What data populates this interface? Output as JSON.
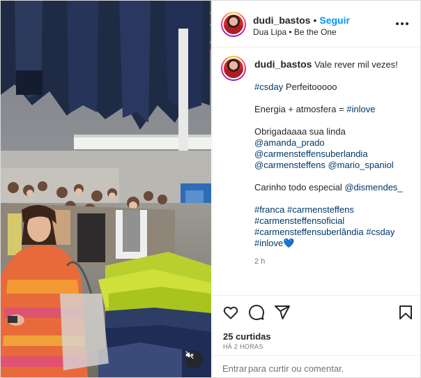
{
  "post": {
    "username": "dudi_bastos",
    "follow_label": "Seguir",
    "audio_artist": "Dua Lipa",
    "audio_track": "Be the One",
    "caption_lines": [
      {
        "segments": [
          {
            "text": "Vale rever mil vezes!",
            "link": false
          }
        ]
      },
      {
        "gap": true
      },
      {
        "segments": [
          {
            "text": "#csday",
            "link": true
          },
          {
            "text": " Perfeitooooo",
            "link": false
          }
        ]
      },
      {
        "gap": true
      },
      {
        "segments": [
          {
            "text": "Energia + atmosfera = ",
            "link": false
          },
          {
            "text": "#inlove",
            "link": true
          }
        ]
      },
      {
        "gap": true
      },
      {
        "segments": [
          {
            "text": "Obrigadaaaa sua linda",
            "link": false
          }
        ]
      },
      {
        "segments": [
          {
            "text": "@amanda_prado",
            "link": true
          }
        ]
      },
      {
        "segments": [
          {
            "text": "@carmensteffensuberlandia",
            "link": true
          }
        ]
      },
      {
        "segments": [
          {
            "text": "@carmensteffens",
            "link": true
          },
          {
            "text": " ",
            "link": false
          },
          {
            "text": "@mario_spaniol",
            "link": true
          }
        ]
      },
      {
        "gap": true
      },
      {
        "segments": [
          {
            "text": "Carinho todo especial ",
            "link": false
          },
          {
            "text": "@dismendes_",
            "link": true
          }
        ]
      },
      {
        "gap": true
      },
      {
        "segments": [
          {
            "text": "#franca",
            "link": true
          },
          {
            "text": " ",
            "link": false
          },
          {
            "text": "#carmensteffens",
            "link": true
          }
        ]
      },
      {
        "segments": [
          {
            "text": "#carmensteffensoficial",
            "link": true
          }
        ]
      },
      {
        "segments": [
          {
            "text": "#carmensteffensuberlândia",
            "link": true
          },
          {
            "text": " ",
            "link": false
          },
          {
            "text": "#csday",
            "link": true
          }
        ]
      },
      {
        "segments": [
          {
            "text": "#inlove",
            "link": true
          },
          {
            "text": "💙",
            "link": false
          }
        ]
      }
    ],
    "comment_time": "2 h",
    "likes_text": "25 curtidas",
    "time_ago": "HÁ 2 HORAS",
    "comment_enter": "Entrar",
    "comment_rest": " para curtir ou comentar."
  },
  "icons": {
    "more": "more-options-icon",
    "like": "heart-icon",
    "comment": "comment-icon",
    "share": "share-icon",
    "save": "bookmark-icon",
    "mute": "sound-off-icon"
  },
  "colors": {
    "accent": "#0095f6",
    "link": "#00376b",
    "muted": "#737373",
    "text": "#262626"
  }
}
